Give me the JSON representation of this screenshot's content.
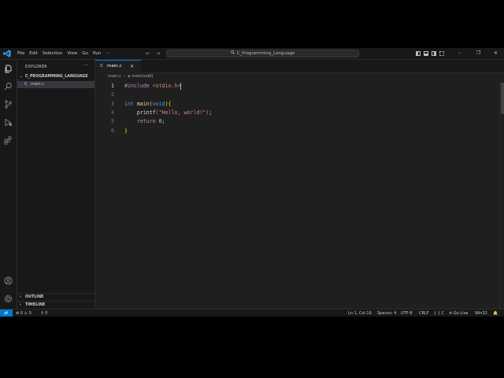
{
  "titlebar": {
    "menu": [
      "File",
      "Edit",
      "Selection",
      "View",
      "Go",
      "Run",
      "···"
    ],
    "back_arrow": "←",
    "forward_arrow": "→",
    "search_text": "C_Programming_Language",
    "window_controls": {
      "minimize": "–",
      "maximize": "❐",
      "close": "✕"
    }
  },
  "sidebar": {
    "title": "EXPLORER",
    "more": "···",
    "folder": {
      "chevron": "⌄",
      "name": "C_PROGRAMMING_LANGUAGE"
    },
    "files": [
      {
        "lang_icon": "C",
        "name": "main.c"
      }
    ],
    "outline": {
      "chevron": "›",
      "name": "OUTLINE"
    },
    "timeline": {
      "chevron": "›",
      "name": "TIMELINE"
    }
  },
  "tabs": [
    {
      "lang_icon": "C",
      "label": "main.c",
      "close": "✕"
    }
  ],
  "editor_actions": {
    "run": "▷",
    "run_menu": "⌄",
    "settings": "⚙",
    "split": "◫",
    "more": "···"
  },
  "breadcrumb": {
    "file": "main.c",
    "sep": "›",
    "symbol": "main(void)"
  },
  "editor": {
    "line_numbers": [
      "1",
      "2",
      "3",
      "4",
      "5",
      "6"
    ],
    "lines": [
      [
        {
          "t": "#include ",
          "c": "pp"
        },
        {
          "t": "<stdio.h>",
          "c": "str"
        }
      ],
      [],
      [
        {
          "t": "int ",
          "c": "kw"
        },
        {
          "t": "main",
          "c": "fn"
        },
        {
          "t": "(",
          "c": "br1"
        },
        {
          "t": "void",
          "c": "kw"
        },
        {
          "t": ")",
          "c": "br1"
        },
        {
          "t": "{",
          "c": "br1"
        }
      ],
      [
        {
          "t": "    printf",
          "c": "fn"
        },
        {
          "t": "(",
          "c": "br2"
        },
        {
          "t": "\"Hello, world!\"",
          "c": "str"
        },
        {
          "t": ")",
          "c": "br2"
        },
        {
          "t": ";",
          "c": "plain"
        }
      ],
      [
        {
          "t": "    return ",
          "c": "pp"
        },
        {
          "t": "0",
          "c": "num"
        },
        {
          "t": ";",
          "c": "plain"
        }
      ],
      [
        {
          "t": "}",
          "c": "br1"
        }
      ]
    ]
  },
  "statusbar": {
    "remote_icon": "⇄",
    "problems": "⊗ 0 ⚠ 0",
    "ports": "⚲ 0",
    "position": "Ln 1, Col 19",
    "spaces": "Spaces: 4",
    "encoding": "UTF-8",
    "eol": "CRLF",
    "language": "{ } C",
    "go_live": "⊚ Go Live",
    "platform": "Win32",
    "bell": "🔔"
  },
  "colors": {
    "accent": "#0078d4",
    "background": "#1f1f1f",
    "sidebar": "#181818"
  }
}
